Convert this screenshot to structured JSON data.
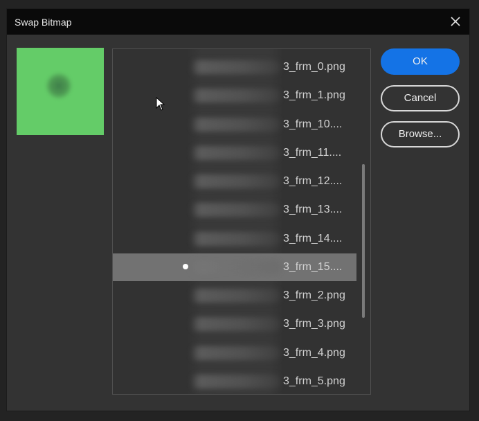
{
  "dialog": {
    "title": "Swap Bitmap",
    "close_icon": "close-icon"
  },
  "preview": {
    "background_color": "#64cc68"
  },
  "file_list": {
    "items": [
      {
        "label": "3_frm_0.png",
        "selected": false
      },
      {
        "label": "3_frm_1.png",
        "selected": false
      },
      {
        "label": "3_frm_10....",
        "selected": false
      },
      {
        "label": "3_frm_11....",
        "selected": false
      },
      {
        "label": "3_frm_12....",
        "selected": false
      },
      {
        "label": "3_frm_13....",
        "selected": false
      },
      {
        "label": "3_frm_14....",
        "selected": false
      },
      {
        "label": "3_frm_15....",
        "selected": true
      },
      {
        "label": "3_frm_2.png",
        "selected": false
      },
      {
        "label": "3_frm_3.png",
        "selected": false
      },
      {
        "label": "3_frm_4.png",
        "selected": false
      },
      {
        "label": "3_frm_5.png",
        "selected": false
      }
    ]
  },
  "buttons": {
    "ok_label": "OK",
    "cancel_label": "Cancel",
    "browse_label": "Browse..."
  },
  "colors": {
    "accent": "#1473e6",
    "selection": "#727272",
    "dialog_bg": "#333333",
    "titlebar_bg": "#0a0a0a"
  }
}
